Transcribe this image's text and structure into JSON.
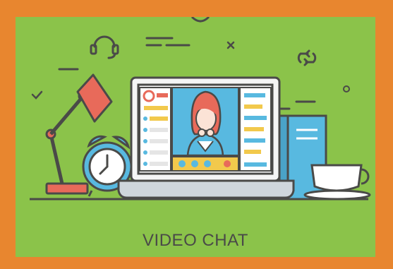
{
  "caption": "VIDEO CHAT",
  "colors": {
    "frame": "#e8862f",
    "background": "#8bc34a",
    "outline": "#4a4a48",
    "lamp": "#e86a5a",
    "clock": "#58b9e0",
    "book": "#58b9e0",
    "video_bg": "#58b9e0",
    "hair": "#e86a5a",
    "call_bar": "#f2c94c",
    "end_call": "#e86a5a"
  },
  "icons": [
    "headset-icon",
    "refresh-icon",
    "check-icon",
    "close-icon",
    "phone-icon",
    "camera-icon",
    "mute-icon",
    "end-call-icon"
  ]
}
